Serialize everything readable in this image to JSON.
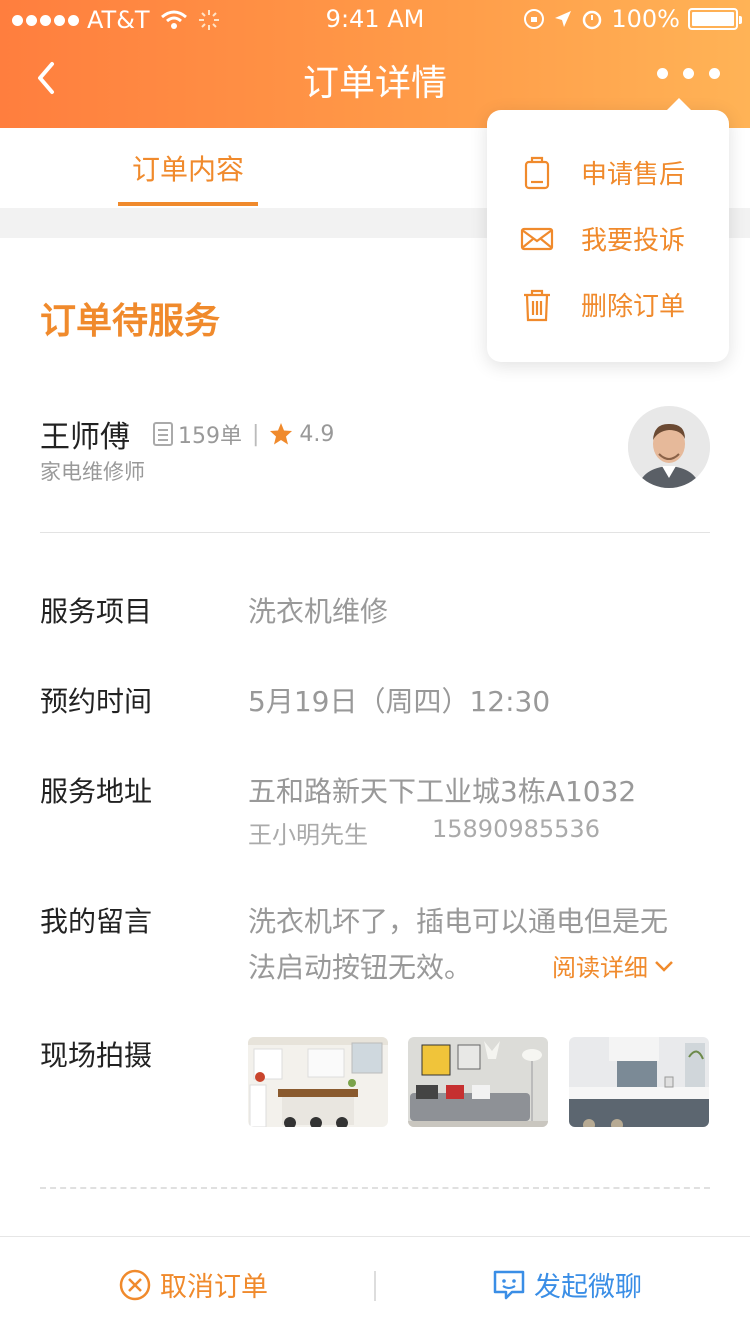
{
  "status_bar": {
    "carrier": "AT&T",
    "time": "9:41 AM",
    "battery": "100%"
  },
  "navbar": {
    "title": "订单详情"
  },
  "tabs": [
    {
      "label": "订单内容",
      "active": true
    }
  ],
  "popup_menu": {
    "items": [
      {
        "label": "申请售后",
        "icon": "clipboard-icon"
      },
      {
        "label": "我要投诉",
        "icon": "mail-icon"
      },
      {
        "label": "删除订单",
        "icon": "trash-icon"
      }
    ]
  },
  "order": {
    "status": "订单待服务",
    "worker": {
      "name": "王师傅",
      "orders": "159单",
      "rating": "4.9",
      "role": "家电维修师"
    },
    "details": {
      "service_label": "服务项目",
      "service_value": "洗衣机维修",
      "time_label": "预约时间",
      "time_value": "5月19日（周四）12:30",
      "address_label": "服务地址",
      "address_value": "五和路新天下工业城3栋A1032",
      "contact_name": "王小明先生",
      "contact_phone": "15890985536",
      "message_label": "我的留言",
      "message_line1": "洗衣机坏了，插电可以通电但是无",
      "message_line2": "法启动按钮无效。",
      "read_more": "阅读详细",
      "photos_label": "现场拍摄"
    }
  },
  "bottom_bar": {
    "cancel_label": "取消订单",
    "chat_label": "发起微聊"
  },
  "colors": {
    "accent": "#f08a2c",
    "header_start": "#ff7e3e",
    "header_end": "#ffb356",
    "chat_blue": "#3a8ee6"
  }
}
